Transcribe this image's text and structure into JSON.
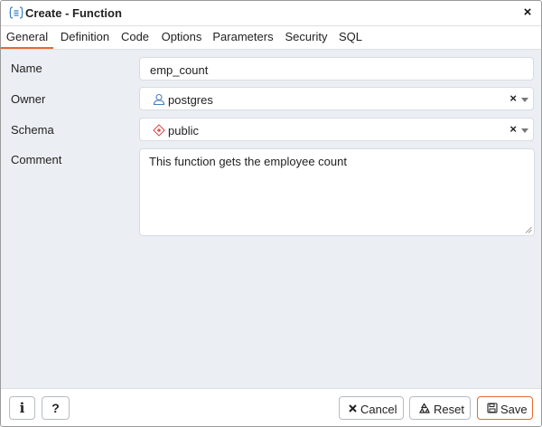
{
  "window": {
    "title": "Create - Function",
    "close_label": "×"
  },
  "tabs": [
    {
      "label": "General",
      "active": true
    },
    {
      "label": "Definition"
    },
    {
      "label": "Code"
    },
    {
      "label": "Options"
    },
    {
      "label": "Parameters"
    },
    {
      "label": "Security"
    },
    {
      "label": "SQL"
    }
  ],
  "form": {
    "name": {
      "label": "Name",
      "value": "emp_count"
    },
    "owner": {
      "label": "Owner",
      "value": "postgres",
      "icon": "user-role-icon"
    },
    "schema": {
      "label": "Schema",
      "value": "public",
      "icon": "schema-icon"
    },
    "comment": {
      "label": "Comment",
      "value": "This function gets the employee count"
    },
    "clear_label": "×"
  },
  "footer": {
    "info_label": "i",
    "help_label": "?",
    "cancel_label": "Cancel",
    "reset_label": "Reset",
    "save_label": "Save"
  },
  "colors": {
    "accent": "#e66a2c",
    "background": "#ebeef3",
    "border": "#d8dce2"
  }
}
